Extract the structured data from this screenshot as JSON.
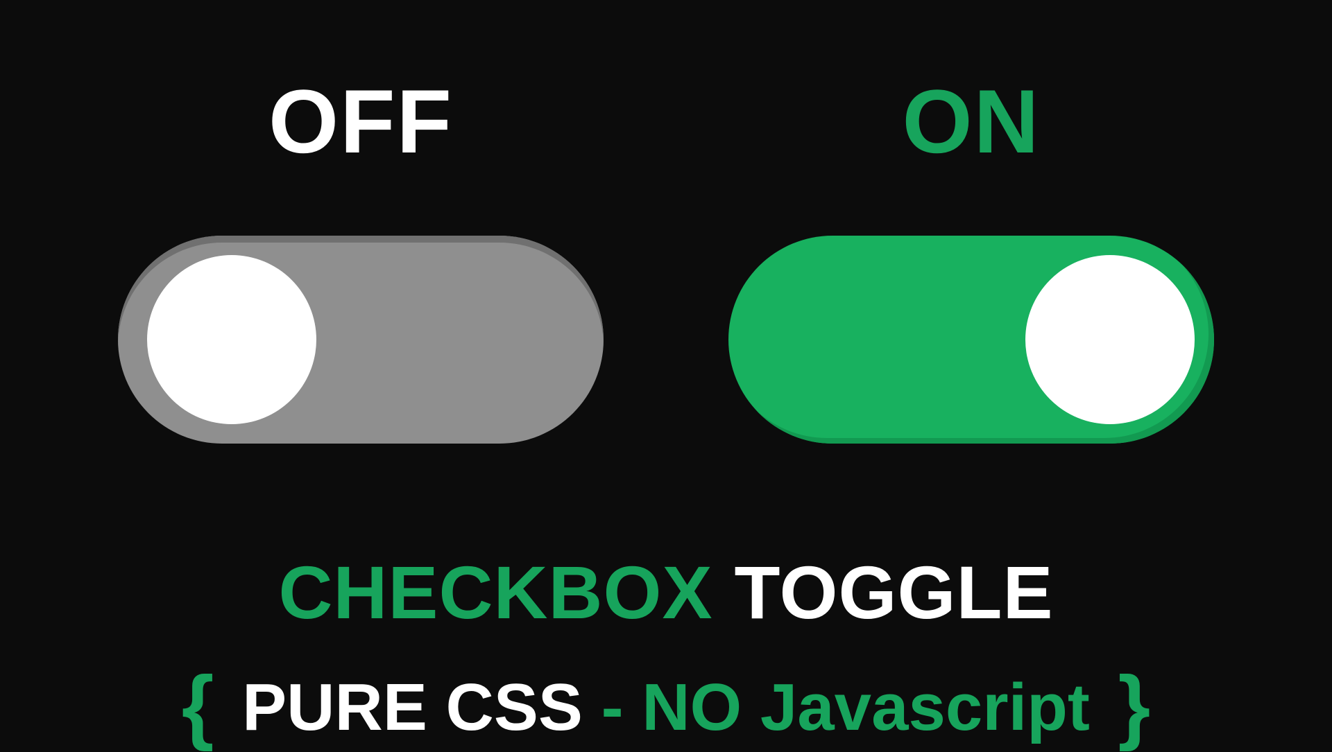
{
  "toggles": {
    "off": {
      "label": "OFF",
      "state": false
    },
    "on": {
      "label": "ON",
      "state": true
    }
  },
  "headline": {
    "row1_word1": "CHECKBOX",
    "row1_word2": "TOGGLE",
    "row2_brace_open": "{",
    "row2_pure_css": "PURE CSS",
    "row2_dash": "-",
    "row2_no_js": "NO Javascript",
    "row2_brace_close": "}"
  },
  "colors": {
    "bg": "#0c0c0c",
    "green": "#17a45c",
    "track_off": "#8f8f8f",
    "thumb": "#ffffff"
  }
}
